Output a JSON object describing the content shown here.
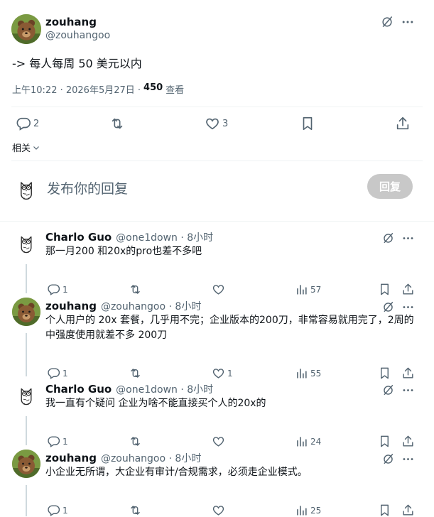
{
  "main_tweet": {
    "name": "zouhang",
    "handle": "@zouhangoo",
    "text": "-> 每人每周 50 美元以内",
    "time": "上午10:22 · 2026年5月27日 ·",
    "views": "450",
    "views_label": "查看",
    "actions": {
      "replies": "2",
      "retweets": "",
      "likes": "3"
    },
    "related": "相关"
  },
  "composer": {
    "placeholder": "发布你的回复",
    "reply_button": "回复"
  },
  "replies": [
    {
      "name": "Charlo Guo",
      "handle": "@one1down · 8小时",
      "avatar": "owl",
      "text": "那一月200 和20x的pro也差不多吧",
      "replies": "1",
      "retweets": "",
      "likes": "",
      "views": "57"
    },
    {
      "name": "zouhang",
      "handle": "@zouhangoo · 8小时",
      "avatar": "bear",
      "text": "个人用户的 20x 套餐，几乎用不完；企业版本的200刀，非常容易就用完了，2周的中强度使用就差不多 200刀",
      "replies": "1",
      "retweets": "",
      "likes": "1",
      "views": "55"
    },
    {
      "name": "Charlo Guo",
      "handle": "@one1down · 8小时",
      "avatar": "owl",
      "text": "我一直有个疑问 企业为啥不能直接买个人的20x的",
      "replies": "1",
      "retweets": "",
      "likes": "",
      "views": "24"
    },
    {
      "name": "zouhang",
      "handle": "@zouhangoo · 8小时",
      "avatar": "bear",
      "text": "小企业无所谓，大企业有审计/合规需求，必须走企业模式。",
      "replies": "1",
      "retweets": "",
      "likes": "",
      "views": "25"
    }
  ],
  "colors": {
    "text": "#0f1419",
    "muted": "#536471",
    "divider": "#eff3f4",
    "reply_button": "#c8c8c8"
  }
}
